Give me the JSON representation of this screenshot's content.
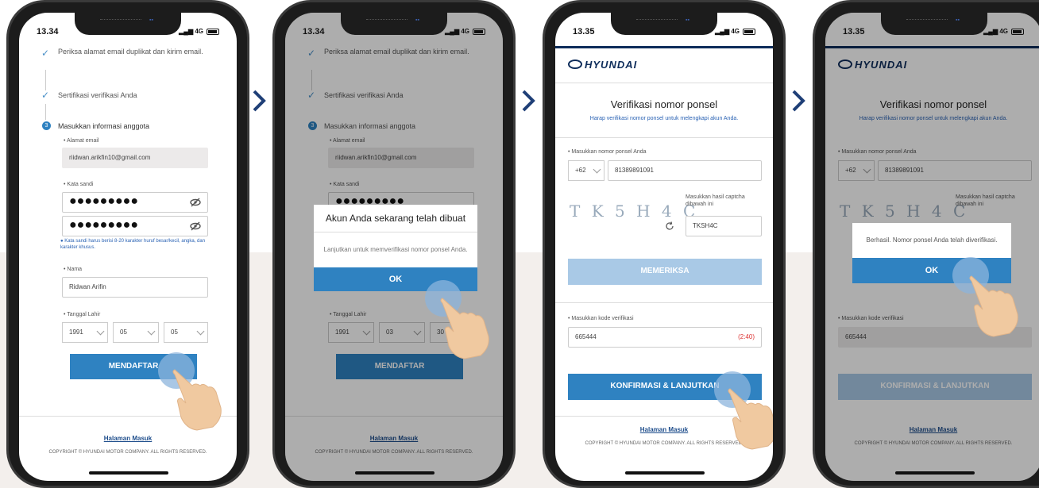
{
  "status_bar": {
    "time1": "13.34",
    "time2": "13.34",
    "time3": "13.35",
    "time4": "13.35",
    "signal": "4G"
  },
  "brand": {
    "logo_text": "HYUNDAI"
  },
  "register": {
    "step1": "Periksa alamat email duplikat dan kirim email.",
    "step2": "Sertifikasi verifikasi Anda",
    "step3": "Masukkan informasi anggota",
    "step3_num": "3",
    "email_label": "Alamat email",
    "email_value": "riidwan.arikfin10@gmail.com",
    "password_label": "Kata sandi",
    "password_mask": "●●●●●●●●●",
    "password_hint": "Kata sandi harus berisi 8-20 karakter huruf besar/kecil, angka, dan karakter khusus.",
    "name_label": "Nama",
    "name_value": "Ridwan Arifin",
    "dob_label": "Tanggal Lahir",
    "dob_year": "1991",
    "dob_month": "05",
    "dob_day": "05",
    "dob2_month": "03",
    "dob2_day": "30",
    "submit": "MENDAFTAR"
  },
  "dialog1": {
    "title": "Akun Anda sekarang telah dibuat",
    "body": "Lanjutkan untuk memverifikasi nomor ponsel Anda.",
    "ok": "OK"
  },
  "verify": {
    "title": "Verifikasi nomor ponsel",
    "subtitle": "Harap verifikasi nomor ponsel untuk melengkapi akun Anda.",
    "phone_label": "Masukkan nomor ponsel Anda",
    "country_code": "+62",
    "phone_value": "81389891091",
    "captcha_label": "Masukkan hasil captcha dibawah ini",
    "captcha_image": "T K 5 H 4 C",
    "captcha_value": "TKSH4C",
    "check_button": "MEMERIKSA",
    "code_label": "Masukkan kode verifikasi",
    "code_value": "665444",
    "timer": "(2:40)",
    "confirm_button": "KONFIRMASI & LANJUTKAN"
  },
  "dialog2": {
    "body": "Berhasil. Nomor ponsel Anda telah diverifikasi.",
    "ok": "OK"
  },
  "footer": {
    "link": "Halaman Masuk",
    "copyright": "COPYRIGHT © HYUNDAI MOTOR COMPANY. ALL RIGHTS RESERVED."
  },
  "colors": {
    "accent": "#2f82c1",
    "brand": "#0d2c5a",
    "arrow": "#1f3f77"
  }
}
